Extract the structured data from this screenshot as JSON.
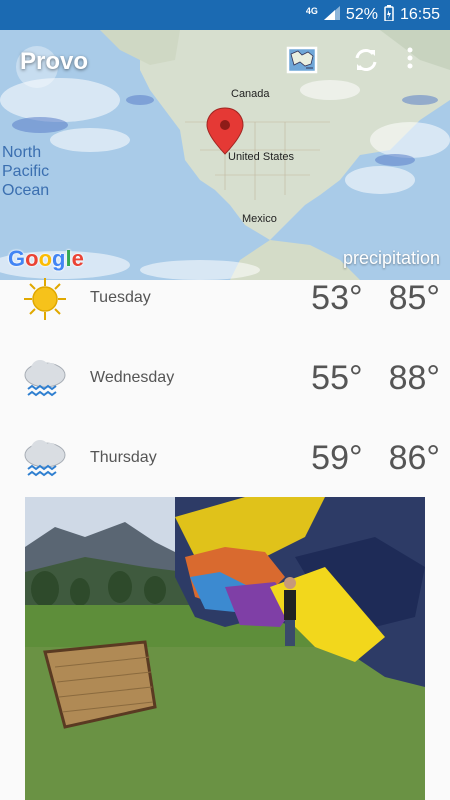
{
  "status_bar": {
    "network": "4G",
    "battery": "52%",
    "time": "16:55"
  },
  "map": {
    "city": "Provo",
    "labels": {
      "canada": "Canada",
      "united_states": "United States",
      "mexico": "Mexico",
      "ocean": "North Pacific Ocean"
    },
    "ocean_lines": [
      "North",
      "Pacific",
      "Ocean"
    ],
    "brand": "Google",
    "layer": "precipitation",
    "buttons": [
      "map-layers-icon",
      "refresh-icon",
      "more-vert-icon"
    ]
  },
  "forecast": [
    {
      "day": "Tuesday",
      "low": "53°",
      "high": "85°",
      "icon": "sunny-icon"
    },
    {
      "day": "Wednesday",
      "low": "55°",
      "high": "88°",
      "icon": "rain-cloud-icon"
    },
    {
      "day": "Thursday",
      "low": "59°",
      "high": "86°",
      "icon": "rain-cloud-icon"
    }
  ],
  "colors": {
    "status_bar": "#1b6ab2",
    "text": "#555555",
    "sun": "#f6c21b"
  }
}
